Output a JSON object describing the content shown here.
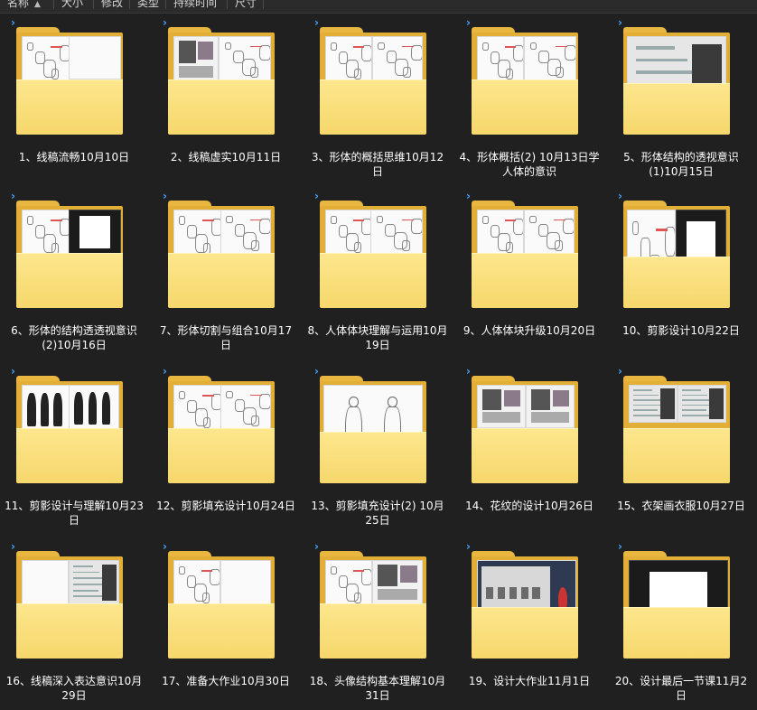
{
  "header": {
    "columns": [
      "名称",
      "大小",
      "修改",
      "类型",
      "持续时间",
      "尺寸"
    ]
  },
  "folders": [
    {
      "label": "1、线稿流畅10月10日"
    },
    {
      "label": "2、线稿虚实10月11日"
    },
    {
      "label": "3、形体的概括思维10月12日"
    },
    {
      "label": "4、形体概括(2) 10月13日学人体的意识"
    },
    {
      "label": "5、形体结构的透视意识(1)10月15日"
    },
    {
      "label": "6、形体的结构透透视意识(2)10月16日"
    },
    {
      "label": "7、形体切割与组合10月17日"
    },
    {
      "label": "8、人体体块理解与运用10月19日"
    },
    {
      "label": "9、人体体块升级10月20日"
    },
    {
      "label": "10、剪影设计10月22日"
    },
    {
      "label": "11、剪影设计与理解10月23日"
    },
    {
      "label": "12、剪影填充设计10月24日"
    },
    {
      "label": "13、剪影填充设计(2) 10月25日"
    },
    {
      "label": "14、花纹的设计10月26日"
    },
    {
      "label": "15、衣架画衣服10月27日"
    },
    {
      "label": "16、线稿深入表达意识10月29日"
    },
    {
      "label": "17、准备大作业10月30日"
    },
    {
      "label": "18、头像结构基本理解10月31日"
    },
    {
      "label": "19、设计大作业11月1日"
    },
    {
      "label": "20、设计最后一节课11月2日"
    }
  ],
  "icons": {
    "expand": "chevron-right-icon",
    "folder": "folder-icon"
  },
  "colors": {
    "background": "#202020",
    "folder_front": "#fde68c",
    "folder_back": "#e3ae36",
    "chevron": "#4aa3ff"
  }
}
